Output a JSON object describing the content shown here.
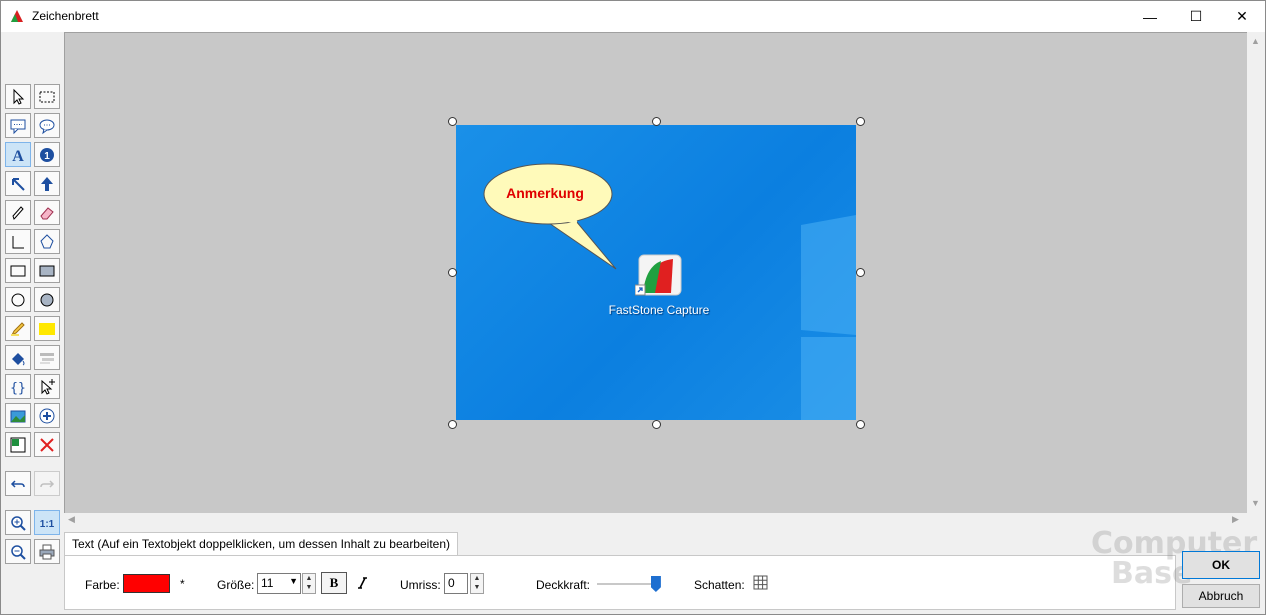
{
  "window": {
    "title": "Zeichenbrett"
  },
  "titlebar_buttons": {
    "minimize": "—",
    "maximize": "☐",
    "close": "✕"
  },
  "toolbar": {
    "tools": [
      {
        "name": "pointer-icon"
      },
      {
        "name": "selection-rect-icon"
      },
      {
        "name": "rect-callout-icon"
      },
      {
        "name": "round-callout-icon"
      },
      {
        "name": "text-icon",
        "active": true
      },
      {
        "name": "step-number-icon",
        "label": "1"
      },
      {
        "name": "arrow-icon"
      },
      {
        "name": "arrow-up-icon"
      },
      {
        "name": "pencil-icon"
      },
      {
        "name": "eraser-icon"
      },
      {
        "name": "line-icon"
      },
      {
        "name": "polygon-icon"
      },
      {
        "name": "rectangle-icon"
      },
      {
        "name": "filled-rectangle-icon"
      },
      {
        "name": "ellipse-icon"
      },
      {
        "name": "filled-ellipse-icon"
      },
      {
        "name": "highlighter-icon"
      },
      {
        "name": "highlight-rect-icon"
      },
      {
        "name": "fill-icon"
      },
      {
        "name": "blur-icon"
      },
      {
        "name": "braces-icon"
      },
      {
        "name": "add-pointer-icon"
      },
      {
        "name": "insert-image-icon"
      },
      {
        "name": "add-circle-icon"
      },
      {
        "name": "object-image-icon"
      },
      {
        "name": "delete-icon"
      },
      {
        "name": "undo-icon"
      },
      {
        "name": "redo-icon",
        "disabled": true
      },
      {
        "name": "zoom-in-icon"
      },
      {
        "name": "actual-size-icon",
        "label": "1:1",
        "active": true
      },
      {
        "name": "zoom-out-icon"
      },
      {
        "name": "print-icon"
      }
    ]
  },
  "canvas": {
    "callout_text": "Anmerkung",
    "desktop_icon_label": "FastStone Capture"
  },
  "properties": {
    "tab_label": "Text (Auf ein Textobjekt doppelklicken, um dessen Inhalt zu bearbeiten)",
    "color_label": "Farbe:",
    "color_value": "#ff0000",
    "asterisk": "*",
    "size_label": "Größe:",
    "size_value": "11",
    "bold_label": "B",
    "italic_label": "I",
    "outline_label": "Umriss:",
    "outline_value": "0",
    "opacity_label": "Deckkraft:",
    "opacity_value": 0.95,
    "shadow_label": "Schatten:"
  },
  "dialog": {
    "ok_label": "OK",
    "cancel_label": "Abbruch"
  },
  "watermark": {
    "line1": "Computer",
    "line2": "Base"
  }
}
